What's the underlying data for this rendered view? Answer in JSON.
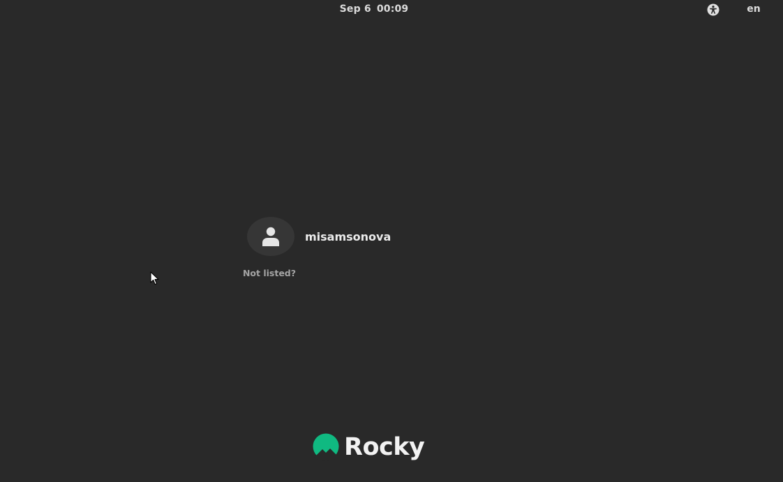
{
  "top_bar": {
    "date": "Sep 6",
    "time": "00:09",
    "language": "en",
    "accessibility_icon": "accessibility-icon"
  },
  "user_list": {
    "users": [
      {
        "name": "misamsonova",
        "avatar_icon": "user-avatar-icon"
      }
    ],
    "not_listed_label": "Not listed?"
  },
  "branding": {
    "logo_text": "Rocky",
    "logo_icon": "rocky-mountain-icon",
    "accent_color": "#10b981"
  },
  "colors": {
    "background": "#292929",
    "avatar_bg": "#363636"
  }
}
